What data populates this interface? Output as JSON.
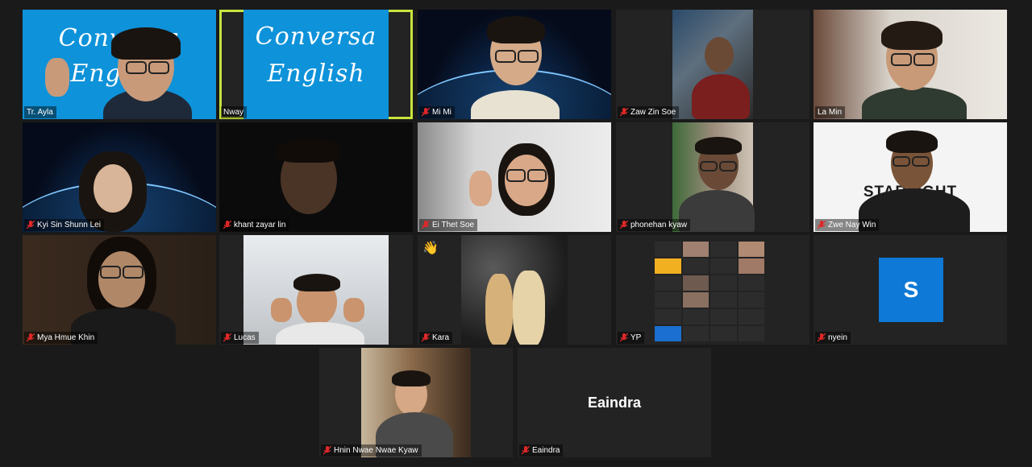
{
  "participants": [
    {
      "name": "Tr. Ayla",
      "muted": false
    },
    {
      "name": "Nway",
      "muted": false
    },
    {
      "name": "Mi Mi",
      "muted": true
    },
    {
      "name": "Zaw Zin Soe",
      "muted": true
    },
    {
      "name": "La Min",
      "muted": false
    },
    {
      "name": "Kyi Sin Shunn Lei",
      "muted": true
    },
    {
      "name": "khant zayar lin",
      "muted": true
    },
    {
      "name": "Ei Thet Soe",
      "muted": true
    },
    {
      "name": "phonehan kyaw",
      "muted": true
    },
    {
      "name": "Zwe Nay Win",
      "muted": true
    },
    {
      "name": "Mya Hmue Khin",
      "muted": true
    },
    {
      "name": "Lucas",
      "muted": true
    },
    {
      "name": "Kara",
      "muted": true
    },
    {
      "name": "YP",
      "muted": true
    },
    {
      "name": "nyein",
      "muted": true
    },
    {
      "name": "Hnin Nwae Nwae Kyaw",
      "muted": true
    },
    {
      "name": "Eaindra",
      "muted": true
    }
  ],
  "banner": {
    "line1": "Conversa",
    "line2": "English"
  },
  "tile_nyein_initial": "S",
  "tile_eaindra_display": "Eaindra",
  "tile_zwe_backdrop": "STARLIGHT",
  "kara_reaction": "👋",
  "colors": {
    "banner_blue": "#0e92d9",
    "active_border": "#c7e43d",
    "muted_red": "#e02828"
  }
}
